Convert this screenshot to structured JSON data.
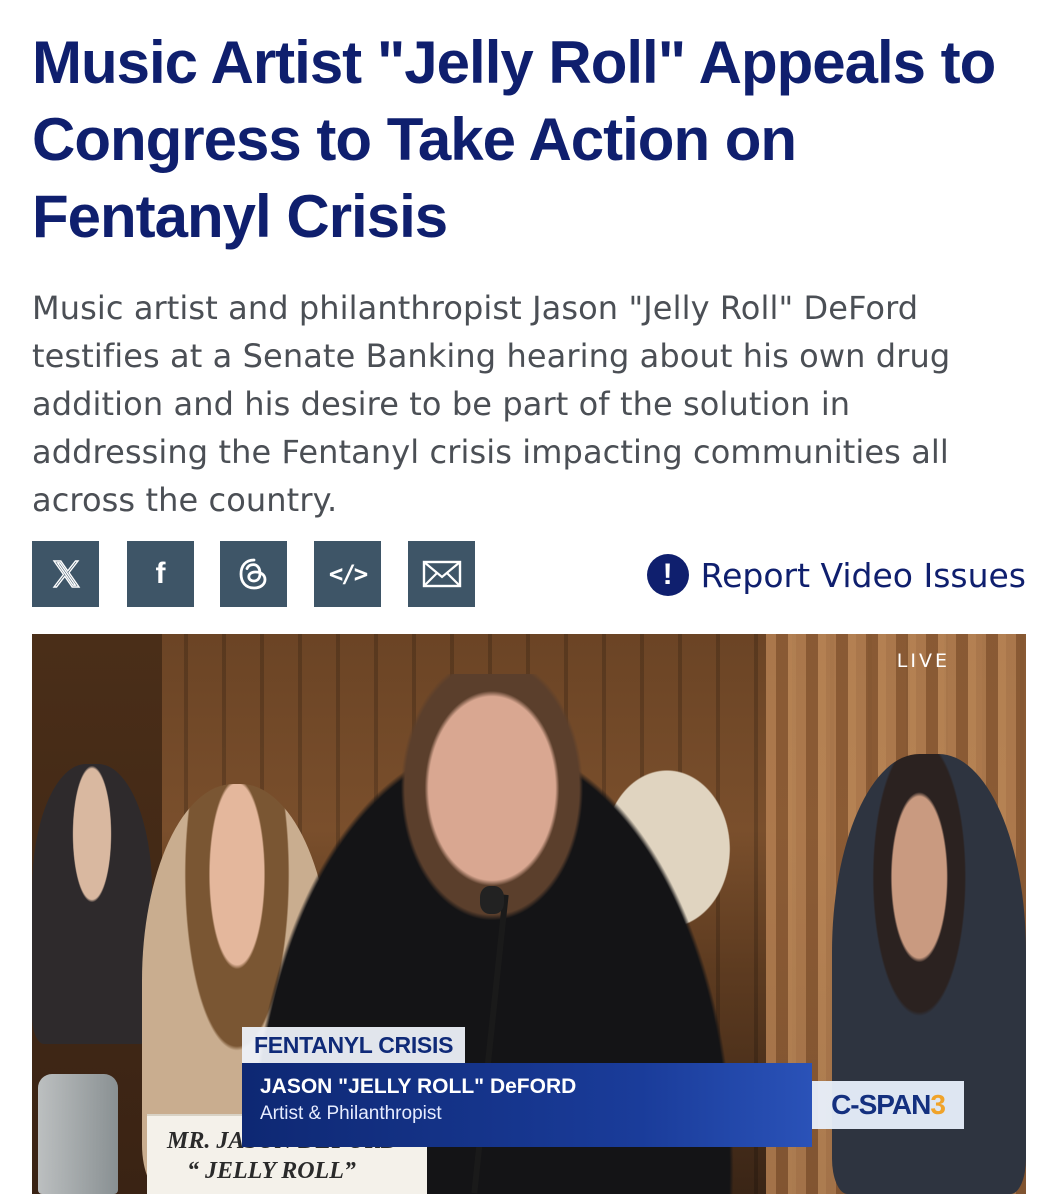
{
  "article": {
    "headline": "Music Artist \"Jelly Roll\" Appeals to Congress to Take Action on Fentanyl Crisis",
    "description": "Music artist and philanthropist Jason \"Jelly Roll\" DeFord testifies at a Senate Banking hearing about his own drug addition and his desire to be part of the solution in addressing the Fentanyl crisis impacting communities all across the country."
  },
  "share": {
    "buttons": [
      {
        "icon": "x-icon"
      },
      {
        "icon": "facebook-icon",
        "glyph": "f"
      },
      {
        "icon": "threads-icon"
      },
      {
        "icon": "embed-icon",
        "glyph": "</>"
      },
      {
        "icon": "email-icon"
      }
    ],
    "button_color": "#3e5567"
  },
  "report": {
    "icon_glyph": "!",
    "label": "Report Video Issues"
  },
  "video": {
    "live_badge": "LIVE",
    "lower_third": {
      "tag": "FENTANYL CRISIS",
      "name": "JASON \"JELLY ROLL\" DeFORD",
      "title": "Artist & Philanthropist"
    },
    "network": {
      "name": "C-SPAN",
      "number": "3"
    },
    "nameplate": {
      "line1": "MR. JASON DEFORD",
      "line2": "“ JELLY ROLL”"
    }
  },
  "colors": {
    "headline": "#0f1f6e",
    "body_text": "#4b4f55",
    "accent": "#0f1f6e"
  }
}
